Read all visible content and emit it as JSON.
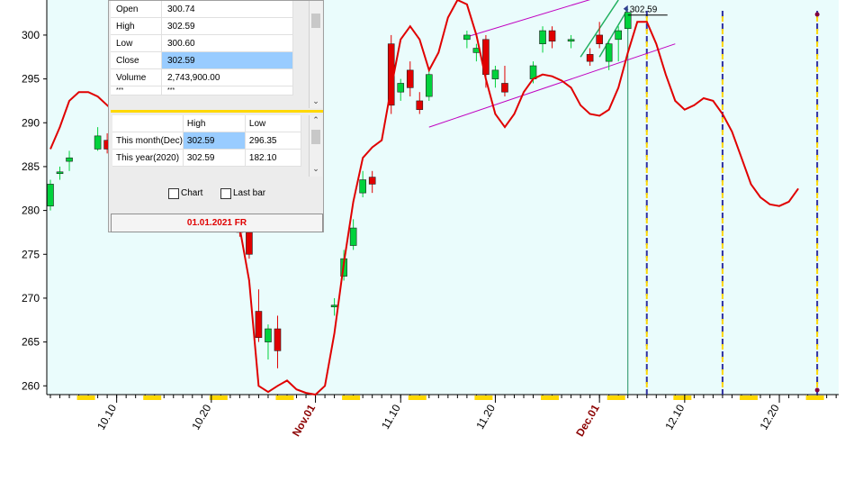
{
  "chart_data": {
    "type": "candlestick",
    "ylim": [
      259,
      304
    ],
    "yticks": [
      260,
      265,
      270,
      275,
      280,
      285,
      290,
      295,
      300
    ],
    "x_tick_labels": [
      {
        "label": "10.10",
        "day": 7,
        "highlight": false
      },
      {
        "label": "10.20",
        "day": 17,
        "highlight": false
      },
      {
        "label": "Nov.01",
        "day": 28,
        "highlight": true
      },
      {
        "label": "11.10",
        "day": 37,
        "highlight": false
      },
      {
        "label": "11.20",
        "day": 47,
        "highlight": false
      },
      {
        "label": "Dec.01",
        "day": 58,
        "highlight": true
      },
      {
        "label": "12.10",
        "day": 67,
        "highlight": false
      },
      {
        "label": "12.20",
        "day": 77,
        "highlight": false
      }
    ],
    "candles": [
      {
        "day": 0,
        "open": 280.5,
        "high": 283.5,
        "low": 280,
        "close": 283
      },
      {
        "day": 1,
        "open": 284.2,
        "high": 285,
        "low": 283.5,
        "close": 284.4
      },
      {
        "day": 2,
        "open": 285.6,
        "high": 286.8,
        "low": 284.5,
        "close": 286
      },
      {
        "day": 5,
        "open": 287,
        "high": 289.5,
        "low": 286.8,
        "close": 288.5
      },
      {
        "day": 6,
        "open": 288,
        "high": 288.8,
        "low": 286.5,
        "close": 287
      },
      {
        "day": 20,
        "open": 278,
        "high": 280,
        "low": 277,
        "close": 277.5
      },
      {
        "day": 21,
        "open": 277.5,
        "high": 278,
        "low": 274.5,
        "close": 275
      },
      {
        "day": 22,
        "open": 268.5,
        "high": 271,
        "low": 265,
        "close": 265.5
      },
      {
        "day": 23,
        "open": 265,
        "high": 267,
        "low": 263,
        "close": 266.5
      },
      {
        "day": 24,
        "open": 266.5,
        "high": 268,
        "low": 262,
        "close": 264
      },
      {
        "day": 30,
        "open": 269,
        "high": 270,
        "low": 268,
        "close": 269.2
      },
      {
        "day": 31,
        "open": 272.5,
        "high": 275.5,
        "low": 272,
        "close": 274.5
      },
      {
        "day": 32,
        "open": 276,
        "high": 279,
        "low": 275.5,
        "close": 278
      },
      {
        "day": 33,
        "open": 282,
        "high": 284.5,
        "low": 281.5,
        "close": 283.5
      },
      {
        "day": 34,
        "open": 283.8,
        "high": 284.5,
        "low": 282,
        "close": 283
      },
      {
        "day": 36,
        "open": 299,
        "high": 300,
        "low": 291,
        "close": 292
      },
      {
        "day": 37,
        "open": 293.5,
        "high": 295,
        "low": 292.5,
        "close": 294.5
      },
      {
        "day": 38,
        "open": 296,
        "high": 297,
        "low": 293,
        "close": 294
      },
      {
        "day": 39,
        "open": 292.5,
        "high": 293.5,
        "low": 291,
        "close": 291.5
      },
      {
        "day": 40,
        "open": 293,
        "high": 296,
        "low": 292.5,
        "close": 295.5
      },
      {
        "day": 44,
        "open": 299.5,
        "high": 300.5,
        "low": 298.5,
        "close": 300
      },
      {
        "day": 45,
        "open": 298,
        "high": 299,
        "low": 297,
        "close": 298.5
      },
      {
        "day": 46,
        "open": 299.5,
        "high": 300,
        "low": 294,
        "close": 295.5
      },
      {
        "day": 47,
        "open": 295,
        "high": 296.5,
        "low": 294,
        "close": 296
      },
      {
        "day": 48,
        "open": 294.5,
        "high": 296.5,
        "low": 293,
        "close": 293.5
      },
      {
        "day": 51,
        "open": 295,
        "high": 297,
        "low": 294.5,
        "close": 296.5
      },
      {
        "day": 52,
        "open": 299,
        "high": 301,
        "low": 298,
        "close": 300.5
      },
      {
        "day": 53,
        "open": 300.5,
        "high": 301,
        "low": 298.5,
        "close": 299.3
      },
      {
        "day": 55,
        "open": 299.3,
        "high": 300,
        "low": 298.5,
        "close": 299.5
      },
      {
        "day": 57,
        "open": 297.8,
        "high": 298.5,
        "low": 296.5,
        "close": 297
      },
      {
        "day": 58,
        "open": 300,
        "high": 301.5,
        "low": 298.5,
        "close": 299
      },
      {
        "day": 59,
        "open": 297,
        "high": 299.5,
        "low": 296,
        "close": 299
      },
      {
        "day": 60,
        "open": 299.5,
        "high": 301,
        "low": 297,
        "close": 300.5
      },
      {
        "day": 61,
        "open": 300.74,
        "high": 302.59,
        "low": 300.6,
        "close": 302.59
      }
    ],
    "forecast_curve": [
      [
        0,
        287
      ],
      [
        1,
        289.5
      ],
      [
        2,
        292.5
      ],
      [
        3,
        293.5
      ],
      [
        4,
        293.5
      ],
      [
        5,
        293
      ],
      [
        6,
        292
      ],
      [
        7,
        291
      ],
      [
        8,
        290
      ],
      [
        9,
        289.5
      ],
      [
        10,
        289
      ],
      [
        11,
        289
      ],
      [
        12,
        290
      ],
      [
        13,
        291
      ],
      [
        14,
        290
      ],
      [
        15,
        288
      ],
      [
        16,
        286
      ],
      [
        17,
        284
      ],
      [
        18,
        282
      ],
      [
        19,
        280
      ],
      [
        20,
        278
      ],
      [
        21,
        272
      ],
      [
        22,
        260
      ],
      [
        23,
        259.3
      ],
      [
        24,
        260
      ],
      [
        25,
        260.6
      ],
      [
        26,
        259.6
      ],
      [
        27,
        259.2
      ],
      [
        28,
        259
      ],
      [
        29,
        260
      ],
      [
        30,
        266
      ],
      [
        31,
        274
      ],
      [
        32,
        281
      ],
      [
        33,
        286
      ],
      [
        34,
        287.2
      ],
      [
        35,
        288
      ],
      [
        36,
        294
      ],
      [
        37,
        299.5
      ],
      [
        38,
        301
      ],
      [
        39,
        299.5
      ],
      [
        40,
        296
      ],
      [
        41,
        298
      ],
      [
        42,
        302
      ],
      [
        43,
        304
      ],
      [
        44,
        303.5
      ],
      [
        45,
        300
      ],
      [
        46,
        295
      ],
      [
        47,
        291
      ],
      [
        48,
        289.5
      ],
      [
        49,
        291
      ],
      [
        50,
        293.5
      ],
      [
        51,
        295
      ],
      [
        52,
        295.5
      ],
      [
        53,
        295.3
      ],
      [
        54,
        294.8
      ],
      [
        55,
        294
      ],
      [
        56,
        292
      ],
      [
        57,
        291
      ],
      [
        58,
        290.8
      ],
      [
        59,
        291.5
      ],
      [
        60,
        294
      ],
      [
        61,
        298
      ],
      [
        62,
        301.5
      ],
      [
        63,
        301.5
      ],
      [
        64,
        299
      ],
      [
        65,
        295.5
      ],
      [
        66,
        292.5
      ],
      [
        67,
        291.5
      ],
      [
        68,
        292
      ],
      [
        69,
        292.8
      ],
      [
        70,
        292.5
      ],
      [
        71,
        291
      ],
      [
        72,
        289
      ],
      [
        73,
        286
      ],
      [
        74,
        283
      ],
      [
        75,
        281.5
      ],
      [
        76,
        280.7
      ],
      [
        77,
        280.5
      ],
      [
        78,
        281
      ],
      [
        79,
        282.5
      ]
    ],
    "channel_lines": [
      {
        "from": [
          40,
          289.5
        ],
        "to": [
          66,
          299
        ]
      },
      {
        "from": [
          44,
          299.8
        ],
        "to": [
          63,
          306
        ]
      }
    ],
    "green_lines": [
      {
        "from": [
          56,
          297.5
        ],
        "to": [
          60,
          304
        ]
      },
      {
        "from": [
          58,
          297.5
        ],
        "to": [
          61,
          303
        ]
      }
    ],
    "vertical_lines": [
      {
        "day": 63,
        "color": "#ffd800",
        "style": "dashed-blue-yellow"
      },
      {
        "day": 71,
        "color": "#ffd800",
        "style": "dashed-blue-yellow"
      },
      {
        "day": 81,
        "color": "#ffd800",
        "style": "dashed-blue-yellow"
      }
    ],
    "last_price_label": "302.59",
    "colors": {
      "up": "#00d23c",
      "down": "#e00000",
      "curve": "#e00000",
      "channel": "#c000c0",
      "green_line": "#20b060",
      "bg_history": "#ffffff",
      "bg_recent": "#eafcfc",
      "vline": "#ffd800"
    }
  },
  "quote_panel": {
    "rows": [
      {
        "label": "Open",
        "value": "300.74"
      },
      {
        "label": "High",
        "value": "302.59"
      },
      {
        "label": "Low",
        "value": "300.60"
      },
      {
        "label": "Close",
        "value": "302.59"
      },
      {
        "label": "Volume",
        "value": "2,743,900.00"
      },
      {
        "label": "***",
        "value": "***"
      }
    ],
    "range_headers": [
      "",
      "High",
      "Low"
    ],
    "range_rows": [
      {
        "label": "This month(Dec)",
        "high": "302.59",
        "low": "296.35"
      },
      {
        "label": "This year(2020)",
        "high": "302.59",
        "low": "182.10"
      }
    ],
    "chart_checkbox": "Chart",
    "lastbar_checkbox": "Last bar",
    "date_label": "01.01.2021 FR"
  }
}
